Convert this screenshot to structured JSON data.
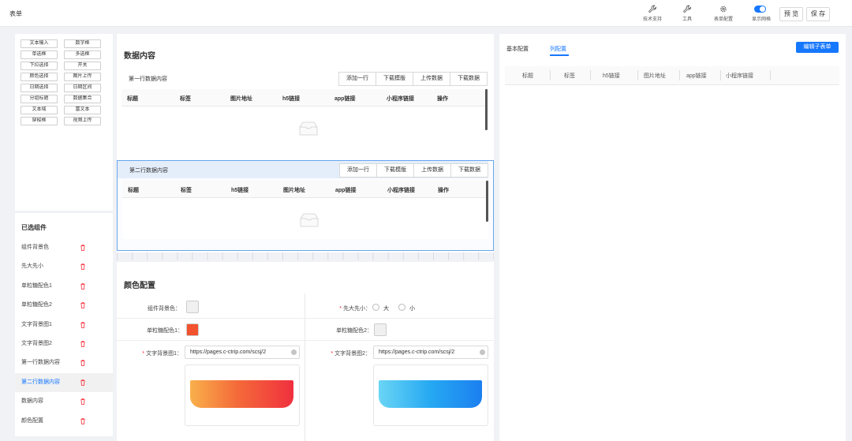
{
  "app": {
    "title": "表单"
  },
  "toolbar": {
    "tools": [
      {
        "label": "技术支持",
        "icon": "wrench-icon"
      },
      {
        "label": "工具",
        "icon": "wrench-icon"
      },
      {
        "label": "表单配置",
        "icon": "gear-icon"
      }
    ],
    "grid_toggle": {
      "label": "显示网格",
      "on": true
    },
    "preview_label": "预 览",
    "save_label": "保 存"
  },
  "components": [
    "文本输入",
    "数字框",
    "单选框",
    "多选框",
    "下拉选择",
    "开关",
    "颜色选择",
    "图片上传",
    "日期选择",
    "日期区间",
    "分组标题",
    "数据集合",
    "文本域",
    "富文本",
    "穿梭框",
    "视频上传"
  ],
  "selected": {
    "title": "已选组件",
    "items": [
      {
        "label": "组件背景色",
        "active": false
      },
      {
        "label": "先大先小",
        "active": false
      },
      {
        "label": "单粒糖配色1",
        "active": false
      },
      {
        "label": "单粒糖配色2",
        "active": false
      },
      {
        "label": "文字背景图1",
        "active": false
      },
      {
        "label": "文字背景图2",
        "active": false
      },
      {
        "label": "第一行数据内容",
        "active": false
      },
      {
        "label": "第二行数据内容",
        "active": true
      },
      {
        "label": "数据内容",
        "active": false
      },
      {
        "label": "颜色配置",
        "active": false
      }
    ]
  },
  "data_section": {
    "title": "数据内容",
    "tables": [
      {
        "caption": "第一行数据内容",
        "selected": false,
        "actions": [
          "添加一行",
          "下载模版",
          "上传数据",
          "下载数据"
        ],
        "columns": [
          "标题",
          "标签",
          "图片地址",
          "h5链接",
          "app链接",
          "小程序链接",
          "操作"
        ]
      },
      {
        "caption": "第二行数据内容",
        "selected": true,
        "actions": [
          "添加一行",
          "下载模版",
          "上传数据",
          "下载数据"
        ],
        "columns": [
          "标题",
          "标签",
          "h5链接",
          "图片地址",
          "app链接",
          "小程序链接",
          "操作"
        ]
      }
    ]
  },
  "color_section": {
    "title": "颜色配置",
    "bg_color": {
      "label": "组件背景色：",
      "color": "#f0f0f0"
    },
    "size_order": {
      "label": "先大先小：",
      "options": [
        "大",
        "小"
      ],
      "required": true
    },
    "candy1": {
      "label": "单粒糖配色1：",
      "color": "#f2522d"
    },
    "candy2": {
      "label": "单粒糖配色2：",
      "color": "#f0f0f0"
    },
    "text_bg1": {
      "label": "文字背景图1：",
      "url": "https://pages.c-ctrip.com/scsj/2",
      "required": true
    },
    "text_bg2": {
      "label": "文字背景图2：",
      "url": "https://pages.c-ctrip.com/scsj/2",
      "required": true
    }
  },
  "right_panel": {
    "tabs": [
      "基本配置",
      "列配置"
    ],
    "active_tab": "列配置",
    "edit_button": "编辑子表单",
    "columns": [
      "标题",
      "标签",
      "h5链接",
      "图片地址",
      "app链接",
      "小程序链接"
    ]
  },
  "colors": {
    "accent": "#1677ff",
    "danger": "#f5222d",
    "selected_border": "#6aa6ec"
  }
}
